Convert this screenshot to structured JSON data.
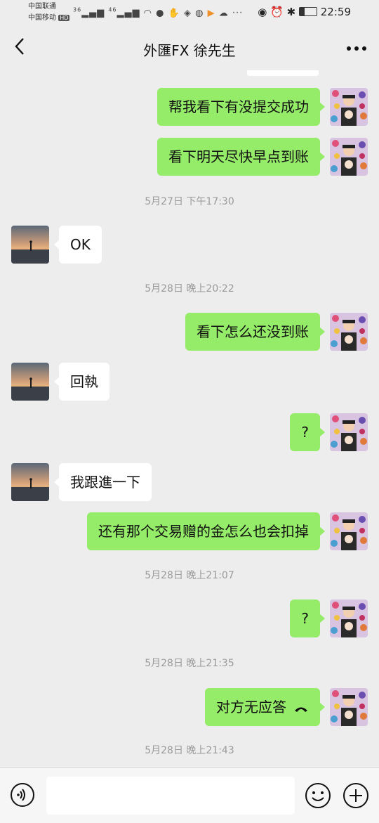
{
  "status_bar": {
    "carrier1": "中国联通",
    "carrier2": "中国移动",
    "hd": "HD",
    "signal1": "36",
    "signal2": "46",
    "time": "22:59"
  },
  "header": {
    "title": "外匯FX 徐先生"
  },
  "messages": [
    {
      "type": "sent",
      "text": "帮我看下有没提交成功"
    },
    {
      "type": "sent",
      "text": "看下明天尽快早点到账"
    },
    {
      "type": "time",
      "text": "5月27日 下午17:30"
    },
    {
      "type": "received",
      "text": "OK"
    },
    {
      "type": "time",
      "text": "5月28日 晚上20:22"
    },
    {
      "type": "sent",
      "text": "看下怎么还没到账"
    },
    {
      "type": "received",
      "text": "回執"
    },
    {
      "type": "sent",
      "text": "?"
    },
    {
      "type": "received",
      "text": "我跟進一下"
    },
    {
      "type": "sent",
      "text": "还有那个交易赠的金怎么也会扣掉"
    },
    {
      "type": "time",
      "text": "5月28日 晚上21:07"
    },
    {
      "type": "sent",
      "text": "?"
    },
    {
      "type": "time",
      "text": "5月28日 晚上21:35"
    },
    {
      "type": "sent",
      "text": "对方无应答"
    },
    {
      "type": "time",
      "text": "5月28日 晚上21:43"
    }
  ],
  "colors": {
    "sent_bubble": "#95ec69",
    "received_bubble": "#ffffff",
    "background": "#ededed"
  }
}
